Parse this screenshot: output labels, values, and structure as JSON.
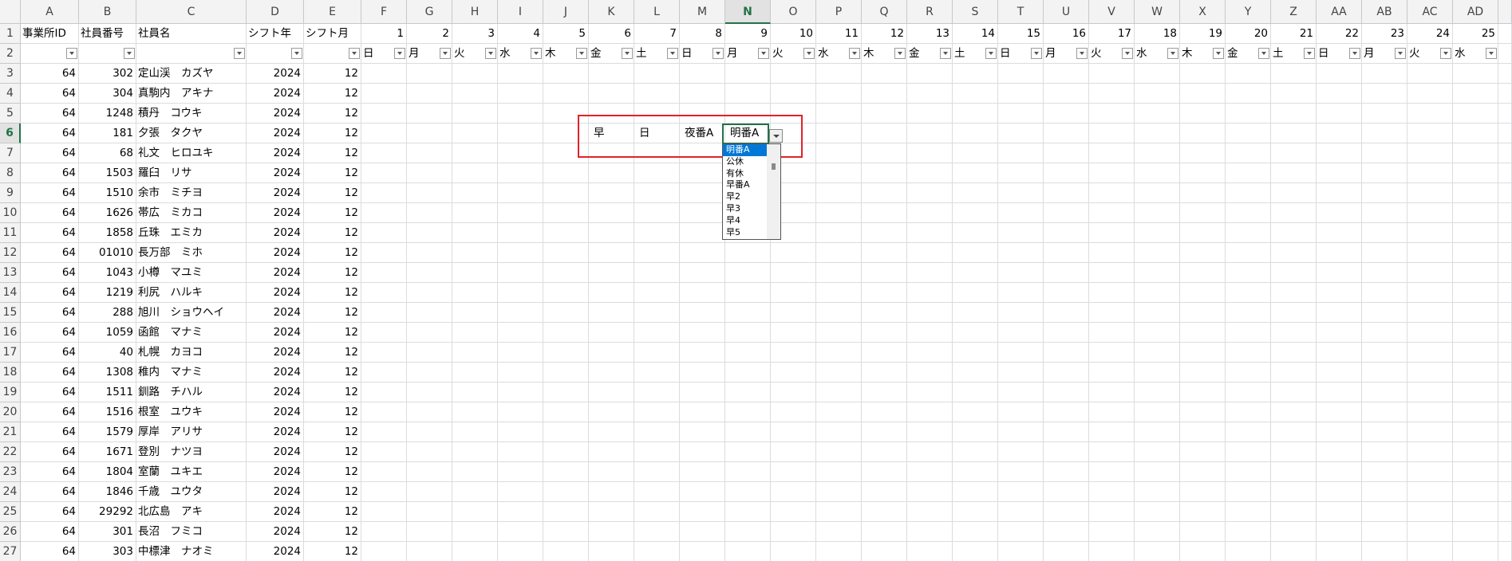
{
  "columns": [
    "A",
    "B",
    "C",
    "D",
    "E",
    "F",
    "G",
    "H",
    "I",
    "J",
    "K",
    "L",
    "M",
    "N",
    "O",
    "P",
    "Q",
    "R",
    "S",
    "T",
    "U",
    "V",
    "W",
    "X",
    "Y",
    "Z",
    "AA",
    "AB",
    "AC",
    "AD"
  ],
  "selected_column": "N",
  "selected_row": 6,
  "header_row": [
    "事業所ID",
    "社員番号",
    "社員名",
    "シフト年",
    "シフト月",
    "1",
    "2",
    "3",
    "4",
    "5",
    "6",
    "7",
    "8",
    "9",
    "10",
    "11",
    "12",
    "13",
    "14",
    "15",
    "16",
    "17",
    "18",
    "19",
    "20",
    "21",
    "22",
    "23",
    "24",
    "25"
  ],
  "weekday_row": [
    "",
    "",
    "",
    "",
    "",
    "日",
    "月",
    "火",
    "水",
    "木",
    "金",
    "土",
    "日",
    "月",
    "火",
    "水",
    "木",
    "金",
    "土",
    "日",
    "月",
    "火",
    "水",
    "木",
    "金",
    "土",
    "日",
    "月",
    "火",
    "水"
  ],
  "row_numbers": [
    1,
    2,
    3,
    4,
    5,
    6,
    7,
    8,
    9,
    10,
    11,
    12,
    13,
    14,
    15,
    16,
    17,
    18,
    19,
    20,
    21,
    22,
    23,
    24,
    25,
    26,
    27
  ],
  "employees": [
    [
      "64",
      "302",
      "定山渓　カズヤ",
      "2024",
      "12"
    ],
    [
      "64",
      "304",
      "真駒内　アキナ",
      "2024",
      "12"
    ],
    [
      "64",
      "1248",
      "積丹　コウキ",
      "2024",
      "12"
    ],
    [
      "64",
      "181",
      "夕張　タクヤ",
      "2024",
      "12"
    ],
    [
      "64",
      "68",
      "礼文　ヒロユキ",
      "2024",
      "12"
    ],
    [
      "64",
      "1503",
      "羅臼　リサ",
      "2024",
      "12"
    ],
    [
      "64",
      "1510",
      "余市　ミチヨ",
      "2024",
      "12"
    ],
    [
      "64",
      "1626",
      "帯広　ミカコ",
      "2024",
      "12"
    ],
    [
      "64",
      "1858",
      "丘珠　エミカ",
      "2024",
      "12"
    ],
    [
      "64",
      "01010",
      "長万部　ミホ",
      "2024",
      "12"
    ],
    [
      "64",
      "1043",
      "小樽　マユミ",
      "2024",
      "12"
    ],
    [
      "64",
      "1219",
      "利尻　ハルキ",
      "2024",
      "12"
    ],
    [
      "64",
      "288",
      "旭川　ショウヘイ",
      "2024",
      "12"
    ],
    [
      "64",
      "1059",
      "函館　マナミ",
      "2024",
      "12"
    ],
    [
      "64",
      "40",
      "札幌　カヨコ",
      "2024",
      "12"
    ],
    [
      "64",
      "1308",
      "稚内　マナミ",
      "2024",
      "12"
    ],
    [
      "64",
      "1511",
      "釧路　チハル",
      "2024",
      "12"
    ],
    [
      "64",
      "1516",
      "根室　ユウキ",
      "2024",
      "12"
    ],
    [
      "64",
      "1579",
      "厚岸　アリサ",
      "2024",
      "12"
    ],
    [
      "64",
      "1671",
      "登別　ナツヨ",
      "2024",
      "12"
    ],
    [
      "64",
      "1804",
      "室蘭　ユキエ",
      "2024",
      "12"
    ],
    [
      "64",
      "1846",
      "千歳　ユウタ",
      "2024",
      "12"
    ],
    [
      "64",
      "29292",
      "北広島　アキ",
      "2024",
      "12"
    ],
    [
      "64",
      "301",
      "長沼　フミコ",
      "2024",
      "12"
    ],
    [
      "64",
      "303",
      "中標津　ナオミ",
      "2024",
      "12"
    ]
  ],
  "shift_cells": {
    "K6": "早",
    "L6": "日",
    "M6": "夜番A",
    "N6": "明番A"
  },
  "dropdown": {
    "options": [
      "明番A",
      "公休",
      "有休",
      "早番A",
      "早2",
      "早3",
      "早4",
      "早5"
    ],
    "selected_index": 0
  },
  "colors": {
    "accent": "#217346",
    "highlight": "#e2222a",
    "selection": "#0078d7"
  },
  "icons": [
    "filter-dropdown-icon",
    "list-dropdown-icon"
  ]
}
